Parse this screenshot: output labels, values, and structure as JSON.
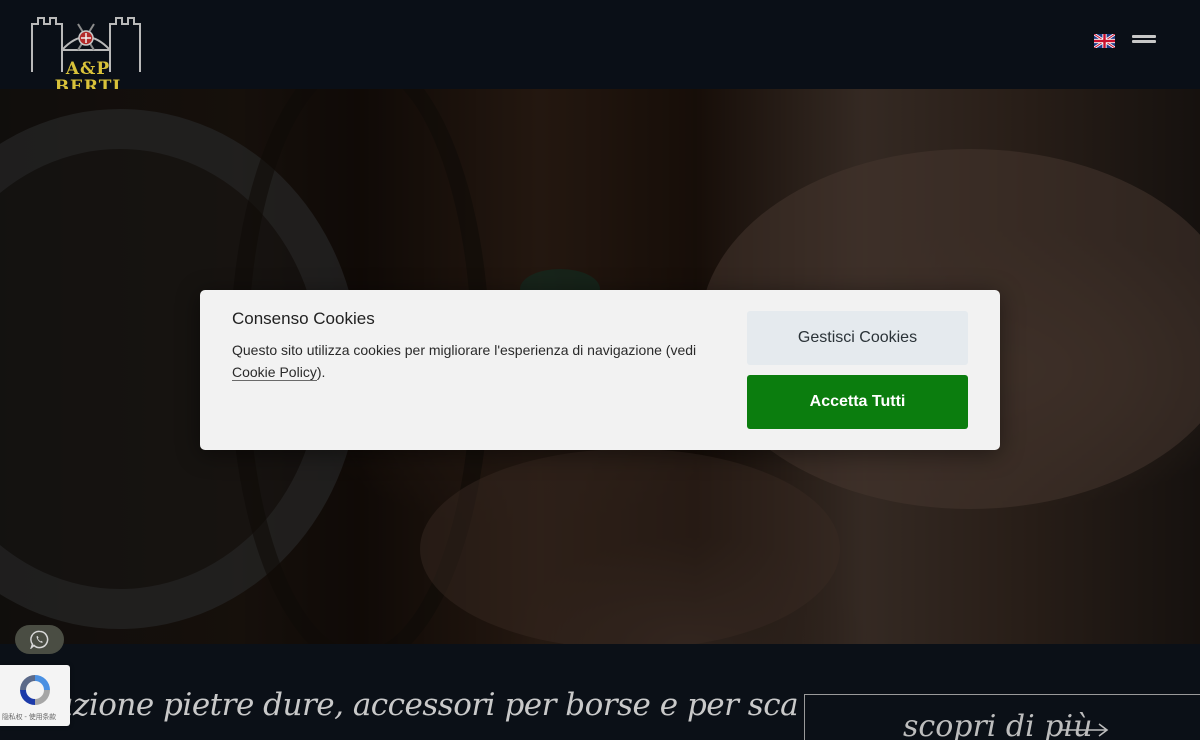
{
  "header": {
    "logo_text": "A&P BERTI",
    "language_icon": "uk-flag-icon",
    "menu_icon": "hamburger-menu-icon"
  },
  "hero": {
    "image": "hands-polishing-stone-on-wheel"
  },
  "bottom": {
    "tagline": "azione pietre dure, accessori per borse e per scarpe in",
    "discover_label": "scopri di più",
    "discover_icon": "arrow-right-icon"
  },
  "floating": {
    "whatsapp_icon": "whatsapp-icon",
    "recaptcha_icon": "recaptcha-icon",
    "recaptcha_links": "隐私权 - 使用条款"
  },
  "cookie_modal": {
    "title": "Consenso Cookies",
    "text_before_link": "Questo sito utilizza cookies per migliorare l'esperienza di navigazione (vedi ",
    "policy_link": "Cookie Policy",
    "text_after_link": ").",
    "manage_button": "Gestisci Cookies",
    "accept_button": "Accetta Tutti"
  },
  "colors": {
    "page_background": "#0b1017",
    "modal_background": "#f2f2f2",
    "accept_button": "#0b7d0e",
    "manage_button": "#e5eaee",
    "logo_gold": "#d8c23a"
  }
}
